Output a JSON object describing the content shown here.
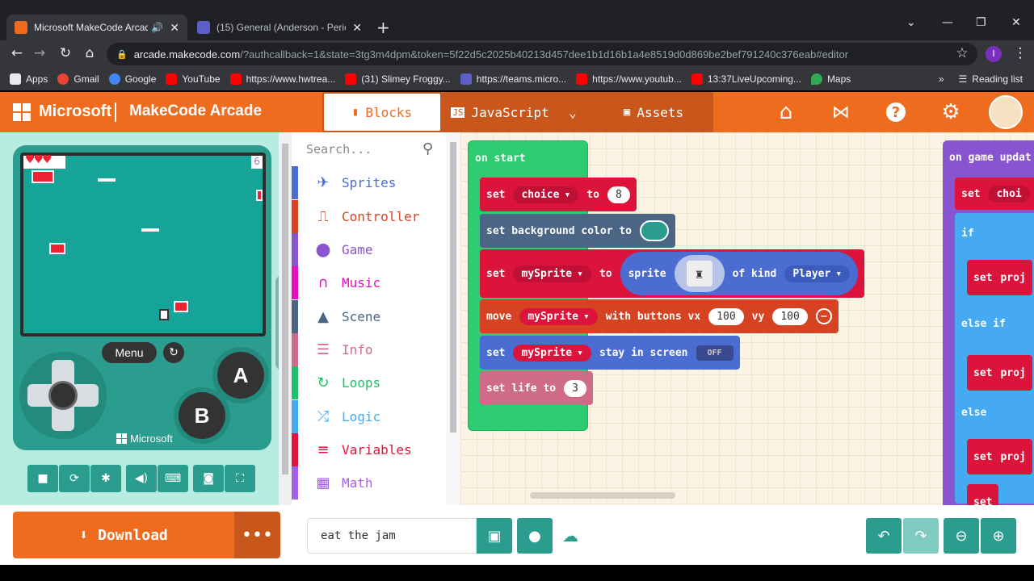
{
  "browser": {
    "tabs": [
      {
        "title": "Microsoft MakeCode Arcade",
        "active": true
      },
      {
        "title": "(15) General (Anderson - Period 7",
        "active": false
      }
    ],
    "url_host": "arcade.makecode.com",
    "url_rest": "/?authcallback=1&state=3tg3m4dpm&token=5f22d5c2025b40213d457dee1b1d16b1a4e8519d0d869be2bef791240c376eab#editor",
    "profile_initial": "I",
    "bookmarks": [
      {
        "label": "Apps",
        "color": "#e8eaed"
      },
      {
        "label": "Gmail",
        "color": "#ea4335"
      },
      {
        "label": "Google",
        "color": "#4285f4"
      },
      {
        "label": "YouTube",
        "color": "#ff0000"
      },
      {
        "label": "https://www.hwtrea...",
        "color": "#ff0000"
      },
      {
        "label": "(31) Slimey Froggy...",
        "color": "#ff0000"
      },
      {
        "label": "https://teams.micro...",
        "color": "#5b5fc7"
      },
      {
        "label": "https://www.youtub...",
        "color": "#ff0000"
      },
      {
        "label": "13:37LiveUpcoming...",
        "color": "#ff0000"
      },
      {
        "label": "Maps",
        "color": "#34a853"
      }
    ],
    "reading_list": "Reading list"
  },
  "header": {
    "brand": "Microsoft",
    "product": "MakeCode Arcade",
    "tabs": {
      "blocks": "Blocks",
      "javascript": "JavaScript",
      "assets": "Assets"
    }
  },
  "simulator": {
    "menu_label": "Menu",
    "a_label": "A",
    "b_label": "B",
    "footer": "Microsoft",
    "score": "6"
  },
  "toolbox": {
    "search_placeholder": "Search...",
    "categories": [
      {
        "label": "Sprites",
        "color": "#4b6cd1",
        "icon": "✈"
      },
      {
        "label": "Controller",
        "color": "#d54322",
        "icon": "🎮"
      },
      {
        "label": "Game",
        "color": "#8854d0",
        "icon": "●"
      },
      {
        "label": "Music",
        "color": "#e30fc0",
        "icon": "🎧"
      },
      {
        "label": "Scene",
        "color": "#4b6584",
        "icon": "▲"
      },
      {
        "label": "Info",
        "color": "#cf6a87",
        "icon": "☰"
      },
      {
        "label": "Loops",
        "color": "#20bf6b",
        "icon": "↻"
      },
      {
        "label": "Logic",
        "color": "#45aaf2",
        "icon": "⤮"
      },
      {
        "label": "Variables",
        "color": "#dc143c",
        "icon": "≡"
      },
      {
        "label": "Math",
        "color": "#a55eea",
        "icon": "▦"
      }
    ]
  },
  "workspace": {
    "on_start": "on start",
    "b1": {
      "set": "set",
      "var": "choice",
      "to": "to",
      "val": "8"
    },
    "b2": {
      "text": "set background color to"
    },
    "b3": {
      "set": "set",
      "var": "mySprite",
      "to": "to",
      "sprite": "sprite",
      "of_kind": "of kind",
      "kind": "Player"
    },
    "b4": {
      "move": "move",
      "var": "mySprite",
      "with": "with buttons vx",
      "vx": "100",
      "vy_label": "vy",
      "vy": "100"
    },
    "b5": {
      "set": "set",
      "var": "mySprite",
      "stay": "stay in screen",
      "toggle": "OFF"
    },
    "b6": {
      "text": "set life to",
      "val": "3"
    },
    "on_update": "on game updat",
    "r": {
      "set1": "set",
      "choice": "choi",
      "if": "if",
      "set2": "set",
      "proj": "proj",
      "elseif": "else if",
      "set3": "set",
      "else": "else",
      "set4": "set",
      "set5": "set"
    }
  },
  "bottom": {
    "download": "Download",
    "project_name": "eat the jam"
  },
  "colors": {
    "orange": "#ef6c1f",
    "teal": "#2a9d8f",
    "sprites_blue": "#4b6cd1",
    "var_red": "#dc143c",
    "loops_green": "#20bf6b"
  }
}
